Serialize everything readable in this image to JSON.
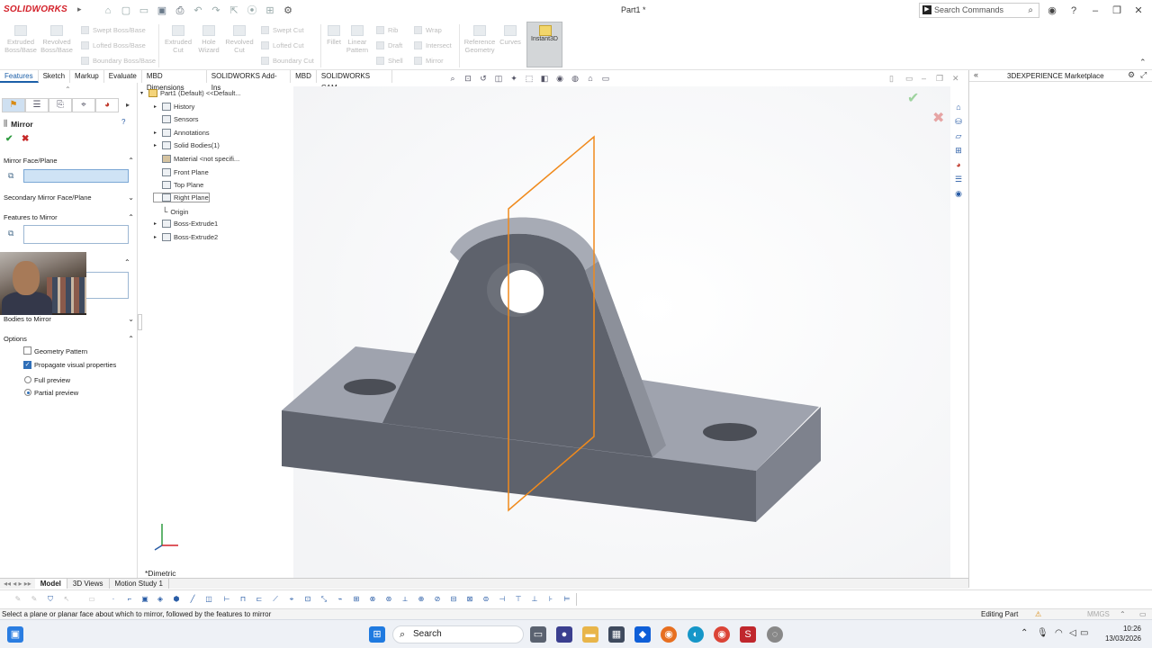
{
  "app": {
    "name": "SOLIDWORKS",
    "document_title": "Part1 *"
  },
  "search": {
    "placeholder": "Search Commands"
  },
  "command_manager": {
    "buttons": [
      {
        "label": "Extruded Boss/Base"
      },
      {
        "label": "Revolved Boss/Base"
      },
      {
        "label": "Extruded Cut"
      },
      {
        "label": "Hole Wizard"
      },
      {
        "label": "Revolved Cut"
      },
      {
        "label": "Fillet"
      },
      {
        "label": "Linear Pattern"
      },
      {
        "label": "Reference Geometry"
      },
      {
        "label": "Curves"
      }
    ],
    "small_rows": [
      "Swept Boss/Base",
      "Lofted Boss/Base",
      "Boundary Boss/Base",
      "Swept Cut",
      "Lofted Cut",
      "Boundary Cut",
      "Rib",
      "Draft",
      "Shell",
      "Wrap",
      "Intersect",
      "Mirror"
    ],
    "instant3d": "Instant3D"
  },
  "tabs": [
    "Features",
    "Sketch",
    "Markup",
    "Evaluate",
    "MBD Dimensions",
    "SOLIDWORKS Add-Ins",
    "MBD",
    "SOLIDWORKS CAM"
  ],
  "property_manager": {
    "title": "Mirror",
    "sections": {
      "mirror_face": "Mirror Face/Plane",
      "secondary_face": "Secondary Mirror Face/Plane",
      "features_to_mirror": "Features to Mirror",
      "bodies_to_mirror": "Bodies to Mirror",
      "options": "Options"
    },
    "options": {
      "geometry_pattern": "Geometry Pattern",
      "propagate_visual": "Propagate visual properties",
      "full_preview": "Full preview",
      "partial_preview": "Partial preview"
    }
  },
  "tree": {
    "root": "Part1 (Default) <<Default...",
    "items": [
      "History",
      "Sensors",
      "Annotations",
      "Solid Bodies(1)",
      "Material <not specifi...",
      "Front Plane",
      "Top Plane",
      "Right Plane",
      "Origin",
      "Boss-Extrude1",
      "Boss-Extrude2"
    ]
  },
  "viewport": {
    "view_label": "*Dimetric"
  },
  "right_panel": {
    "title": "3DEXPERIENCE Marketplace"
  },
  "bottom_tabs": [
    "Model",
    "3D Views",
    "Motion Study 1"
  ],
  "status": {
    "message": "Select a plane or planar face about which to mirror, followed by the features to mirror",
    "mode": "Editing Part",
    "units": "MMGS"
  },
  "taskbar": {
    "search": "Search",
    "time": "10:26",
    "date": "13/03/2026"
  },
  "colors": {
    "accent": "#1c5fa8",
    "plane": "#f08a1c",
    "model": "#5f636d",
    "brand": "#d32029"
  }
}
